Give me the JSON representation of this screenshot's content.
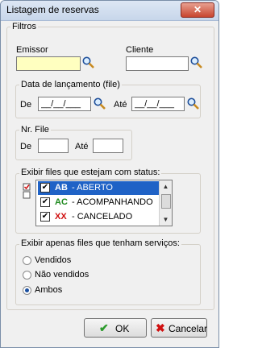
{
  "window": {
    "title": "Listagem de reservas",
    "close_symbol": "✕"
  },
  "filtros": {
    "label": "Filtros",
    "emissor": {
      "label": "Emissor",
      "value": ""
    },
    "cliente": {
      "label": "Cliente",
      "value": ""
    }
  },
  "data_lancamento": {
    "label": "Data de lançamento (file)",
    "de_label": "De",
    "de_value": "__/__/___",
    "ate_label": "Até",
    "ate_value": "__/__/___"
  },
  "nr_file": {
    "label": "Nr. File",
    "de_label": "De",
    "de_value": "",
    "ate_label": "Até",
    "ate_value": ""
  },
  "status": {
    "label": "Exibir files que estejam com status:",
    "items": [
      {
        "code": "AB",
        "text": " - ABERTO",
        "checked": true,
        "color": "#000000"
      },
      {
        "code": "AC",
        "text": " - ACOMPANHANDO",
        "checked": true,
        "color": "#1f8a1f"
      },
      {
        "code": "XX",
        "text": " - CANCELADO",
        "checked": true,
        "color": "#d01010"
      }
    ]
  },
  "servicos": {
    "label": "Exibir apenas files que tenham serviços:",
    "options": [
      {
        "label": "Vendidos",
        "selected": false
      },
      {
        "label": "Não vendidos",
        "selected": false
      },
      {
        "label": "Ambos",
        "selected": true
      }
    ]
  },
  "buttons": {
    "ok_label": "OK",
    "cancel_label": "Cancelar"
  },
  "icons": {
    "lookup": "magnifier-icon",
    "ok": "checkmark-icon",
    "cancel": "x-icon"
  }
}
